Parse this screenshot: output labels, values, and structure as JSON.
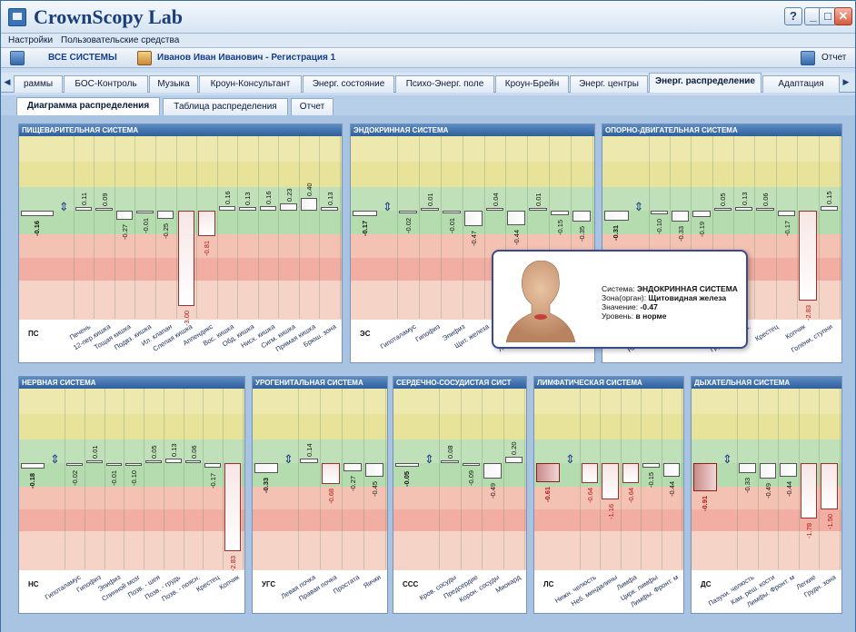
{
  "window": {
    "title": "CrownScopy Lab",
    "help": "?"
  },
  "menu": [
    "Настройки",
    "Пользовательские средства"
  ],
  "toolbar": {
    "all_systems": "ВСЕ СИСТЕМЫ",
    "person": "Иванов Иван Иванович - Регистрация 1",
    "report": "Отчет"
  },
  "tabs": [
    "раммы",
    "БОС-Контроль",
    "Музыка",
    "Кроун-Консультант",
    "Энерг. состояние",
    "Психо-Энерг. поле",
    "Кроун-Брейн",
    "Энерг. центры",
    "Энерг. распределение",
    "Адаптация"
  ],
  "active_tab": "Энерг. распределение",
  "subtabs": [
    "Диаграмма распределения",
    "Таблица распределения",
    "Отчет"
  ],
  "panels": [
    {
      "title": "ПИЩЕВАРИТЕЛЬНАЯ СИСТЕМА",
      "sys": "ПС",
      "sys_value": "-0.16",
      "organs": [
        "Печень",
        "12-пер.кишка",
        "Тощая кишка",
        "Подвз. кишка",
        "Ил. клапан",
        "Слепая кишка",
        "Аппендикс",
        "Вос. кишка",
        "Обд. кишка",
        "Нисх. кишка",
        "Сигм. кишка",
        "Прямая кишка",
        "Брюш. зона"
      ],
      "values": [
        "0.11",
        "0.09",
        "-0.27",
        "-0.01",
        "-0.25",
        "-3.00",
        "-0.81",
        "0.16",
        "0.13",
        "0.16",
        "0.23",
        "0.40",
        "0.13"
      ]
    },
    {
      "title": "ЭНДОКРИННАЯ СИСТЕМА",
      "sys": "ЭС",
      "sys_value": "-0.17",
      "organs": [
        "Гипоталамус",
        "Гипофиз",
        "Эпифиз",
        "Щит. железа",
        "Тимус",
        "Лимф. железа",
        "Надпоч.",
        "Поджел."
      ],
      "values": [
        "-0.02",
        "0.01",
        "-0.01",
        "-0.47",
        "0.04",
        "-0.44",
        "0.01",
        "-0.15",
        "-0.35"
      ]
    },
    {
      "title": "ОПОРНО-ДВИГАТЕЛЬНАЯ СИСТЕМА",
      "sys": "ОДС",
      "sys_value": "-0.31",
      "organs": [
        "Нижн. челюсть",
        "Пазухи",
        "Кам. кости",
        "Грудн. - поясн.",
        "Крестец",
        "Копчик",
        "Голени, ступни"
      ],
      "values": [
        "-0.10",
        "-0.33",
        "-0.19",
        "0.05",
        "0.13",
        "0.06",
        "-0.17",
        "-2.83",
        "0.15"
      ]
    },
    {
      "title": "НЕРВНАЯ СИСТЕМА",
      "sys": "НС",
      "sys_value": "-0.18",
      "organs": [
        "Гипоталамус",
        "Гипофиз",
        "Эпифиз",
        "Спинной мозг",
        "Позв. - шея",
        "Позв. - грудь",
        "Позв. - поясн.",
        "Крестец",
        "Копчик"
      ],
      "values": [
        "-0.02",
        "0.01",
        "-0.01",
        "-0.10",
        "0.05",
        "0.13",
        "0.06",
        "-0.17",
        "-2.83"
      ]
    },
    {
      "title": "УРОГЕНИТАЛЬНАЯ СИСТЕМА",
      "sys": "УГС",
      "sys_value": "-0.33",
      "organs": [
        "Левая почка",
        "Правая почка",
        "Простата",
        "Яички"
      ],
      "values": [
        "0.14",
        "-0.68",
        "-0.27",
        "-0.45"
      ]
    },
    {
      "title": "СЕРДЕЧНО-СОСУДИСТАЯ СИСТ",
      "sys": "ССС",
      "sys_value": "-0.05",
      "organs": [
        "Кров. сосуды",
        "Предсердие",
        "Корон. сосуды",
        "Миокард"
      ],
      "values": [
        "0.08",
        "-0.09",
        "-0.49",
        "0.20"
      ]
    },
    {
      "title": "ЛИМФАТИЧЕСКАЯ СИСТЕМА",
      "sys": "ЛС",
      "sys_value": "-0.61",
      "organs": [
        "Нижн. челюсть",
        "Неб. миндалины",
        "Лимфа",
        "Цирк. лимфы",
        "Лимфы. Фронт. м"
      ],
      "values": [
        "-0.64",
        "-1.16",
        "-0.64",
        "-0.15",
        "-0.44"
      ]
    },
    {
      "title": "ДЫХАТЕЛЬНАЯ СИСТЕМА",
      "sys": "ДС",
      "sys_value": "-0.91",
      "organs": [
        "Пазухи. челюсть",
        "Кам. реш. кости",
        "Лимфы. Фронт. м",
        "Легкие",
        "Грудн. зона"
      ],
      "values": [
        "-0.33",
        "-0.49",
        "-0.44",
        "-1.78",
        "-1.50"
      ]
    }
  ],
  "tooltip": {
    "system_label": "Система:",
    "system_value": "ЭНДОКРИННАЯ СИСТЕМА",
    "zone_label": "Зона(орган):",
    "zone_value": "Щитовидная железа",
    "value_label": "Значение:",
    "value_value": "-0.47",
    "level_label": "Уровень:",
    "level_value": "в норме"
  }
}
